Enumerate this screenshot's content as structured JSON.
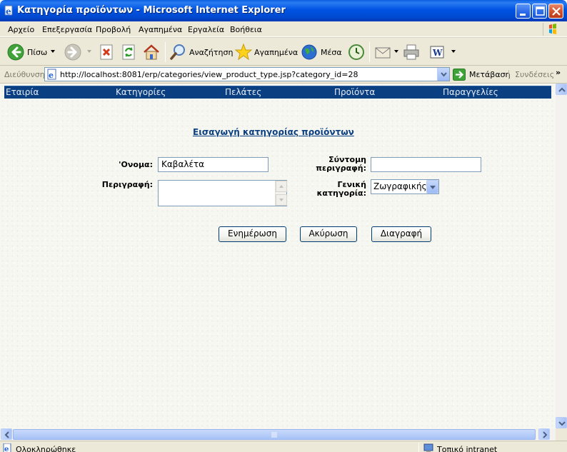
{
  "window": {
    "title": "Κατηγορία προϊόντων - Microsoft Internet Explorer"
  },
  "menu": [
    "Αρχείο",
    "Επεξεργασία",
    "Προβολή",
    "Αγαπημένα",
    "Εργαλεία",
    "Βοήθεια"
  ],
  "toolbar": {
    "back_label": "Πίσω",
    "search_label": "Αναζήτηση",
    "favorites_label": "Αγαπημένα",
    "media_label": "Μέσα"
  },
  "address": {
    "label": "Διεύθυνση",
    "url": "http://localhost:8081/erp/categories/view_product_type.jsp?category_id=28",
    "go_label": "Μετάβαση",
    "links_label": "Συνδέσεις",
    "chevron": "»"
  },
  "nav": [
    "Εταιρία",
    "Κατηγορίες",
    "Πελάτες",
    "Προϊόντα",
    "Παραγγελίες"
  ],
  "form": {
    "title": "Εισαγωγή κατηγορίας προϊόντων",
    "name_label": "'Ονομα:",
    "name_value": "Καβαλέτα",
    "description_label": "Περιγραφή:",
    "description_value": "",
    "short_desc_label_1": "Σύντομη",
    "short_desc_label_2": "περιγραφή:",
    "short_desc_value": "",
    "general_cat_label_1": "Γενική",
    "general_cat_label_2": "κατηγορία:",
    "general_cat_value": "Ζωγραφικής",
    "update_button": "Ενημέρωση",
    "cancel_button": "Ακύρωση",
    "delete_button": "Διαγραφή"
  },
  "status": {
    "text": "Ολοκληρώθηκε",
    "zone": "Τοπικό intranet"
  },
  "colors": {
    "nav_bar": "#0a3f82",
    "title_link": "#0a3f82",
    "titlebar": "#0054e3"
  }
}
